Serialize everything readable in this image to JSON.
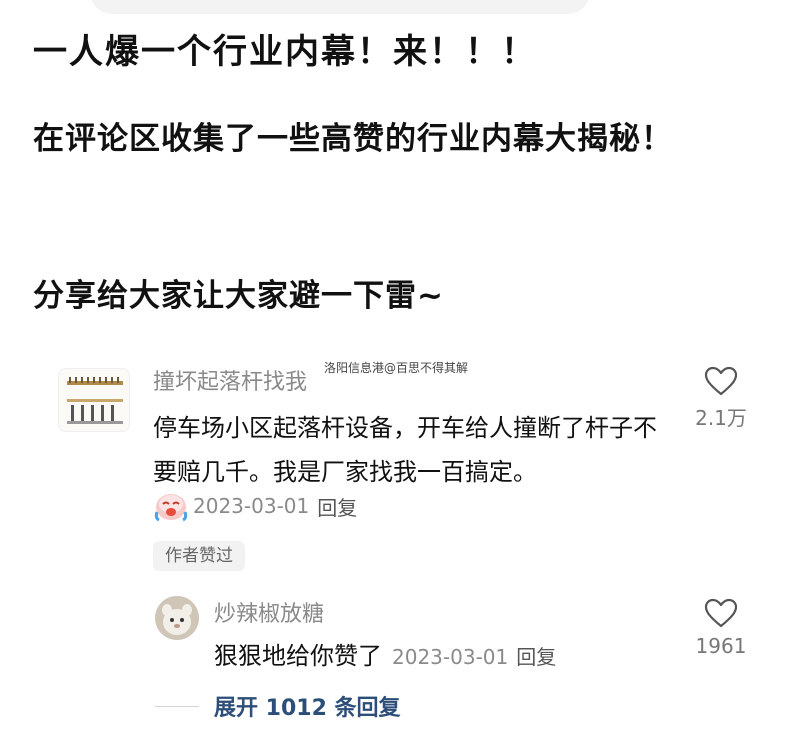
{
  "post": {
    "title": "一人爆一个行业内幕！来！！！",
    "body": "在评论区收集了一些高赞的行业内幕大揭秘！",
    "share": "分享给大家让大家避一下雷~"
  },
  "watermark": "洛阳信息港@百思不得其解",
  "comment": {
    "author": "撞坏起落杆找我",
    "text": "停车场小区起落杆设备，开车给人撞断了杆子不要赔几千。我是厂家找我一百搞定。",
    "date": "2023-03-01",
    "reply_label": "回复",
    "author_liked": "作者赞过",
    "like_count": "2.1万",
    "avatar_icon": "barrier-gate-icon",
    "sticker_icon": "crying-laughing-sticker"
  },
  "reply": {
    "author": "炒辣椒放糖",
    "text": "狠狠地给你赞了",
    "date": "2023-03-01",
    "reply_label": "回复",
    "like_count": "1961",
    "avatar_icon": "animal-avatar-icon"
  },
  "expand": {
    "label": "展开 1012 条回复"
  },
  "colors": {
    "muted": "#8a8a8a",
    "link": "#2d4e78",
    "text": "#111111"
  }
}
